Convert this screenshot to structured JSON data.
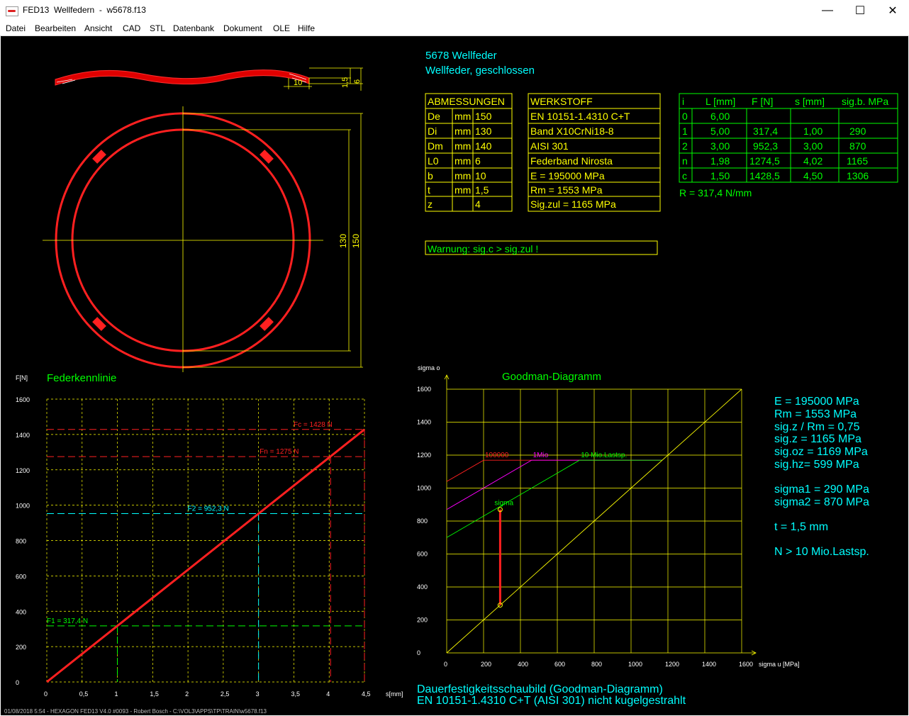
{
  "window": {
    "title": "FED13  Wellfedern  -  w5678.f13",
    "controls": {
      "minimize": "—",
      "maximize": "☐",
      "close": "✕"
    }
  },
  "menu": [
    "Datei",
    "Bearbeiten",
    "Ansicht",
    "CAD",
    "STL",
    "Datenbank",
    "Dokument",
    "OLE",
    "Hilfe"
  ],
  "header": {
    "title": "5678 Wellfeder",
    "subtitle": "Wellfeder, geschlossen"
  },
  "drawing": {
    "dims": {
      "b": "10",
      "t": "1,5",
      "l0": "6",
      "di": "130",
      "de": "150"
    }
  },
  "abmessungen": {
    "header": "ABMESSUNGEN",
    "rows": [
      [
        "De",
        "mm",
        "150"
      ],
      [
        "Di",
        "mm",
        "130"
      ],
      [
        "Dm",
        "mm",
        "140"
      ],
      [
        "L0",
        "mm",
        "6"
      ],
      [
        "b",
        "mm",
        "10"
      ],
      [
        "t",
        "mm",
        "1,5"
      ],
      [
        "z",
        "",
        "4"
      ]
    ]
  },
  "werkstoff": {
    "header": "WERKSTOFF",
    "rows": [
      "EN 10151-1.4310 C+T",
      "Band X10CrNi18-8",
      "AISI 301",
      "Federband Nirosta",
      "E = 195000 MPa",
      "Rm = 1553 MPa",
      "Sig.zul = 1165 MPa"
    ]
  },
  "loadtable": {
    "headers": [
      "i",
      "L [mm]",
      "F [N]",
      "s [mm]",
      "sig.b. MPa"
    ],
    "rows": [
      [
        "0",
        "6,00",
        "",
        "",
        ""
      ],
      [
        "1",
        "5,00",
        "317,4",
        "1,00",
        "290"
      ],
      [
        "2",
        "3,00",
        "952,3",
        "3,00",
        "870"
      ],
      [
        "n",
        "1,98",
        "1274,5",
        "4,02",
        "1165"
      ],
      [
        "c",
        "1,50",
        "1428,5",
        "4,50",
        "1306"
      ]
    ],
    "rate": "R = 317,4 N/mm"
  },
  "warning": "Warnung: sig.c > sig.zul !",
  "results": {
    "lines1": [
      "E = 195000 MPa",
      "Rm = 1553 MPa",
      "sig.z / Rm = 0,75",
      "sig.z = 1165 MPa",
      "sig.oz = 1169 MPa",
      "sig.hz=  599 MPa"
    ],
    "lines2": [
      "sigma1 =  290 MPa",
      "sigma2 =  870 MPa"
    ],
    "t": "t  = 1,5 mm",
    "n": "N > 10 Mio.Lastsp."
  },
  "footer": {
    "title1": "Dauerfestigkeitsschaubild (Goodman-Diagramm)",
    "title2": "EN 10151-1.4310 C+T (AISI 301) nicht kugelgestrahlt",
    "status": "01/08/2018 5:54 - HEXAGON FED13 V4.0 #0093 - Robert Bosch - C:\\VOL3\\APPS\\TP\\TRAIN\\w5678.f13"
  },
  "colors": {
    "canvas": "#000000",
    "yellow": "#ffff00",
    "cyan": "#00ffff",
    "green": "#00ff00",
    "red": "#ff0000",
    "magenta": "#ff00ff"
  },
  "chart_data": [
    {
      "type": "line",
      "title": "Federkennlinie",
      "ylabel": "F[N]",
      "xlabel": "s[mm]",
      "xlim": [
        0,
        4.5
      ],
      "ylim": [
        0,
        1600
      ],
      "x_ticks": [
        "0",
        "0,5",
        "1",
        "1,5",
        "2",
        "2,5",
        "3",
        "3,5",
        "4",
        "4,5"
      ],
      "y_ticks": [
        "0",
        "200",
        "400",
        "600",
        "800",
        "1000",
        "1200",
        "1400",
        "1600"
      ],
      "series": [
        {
          "x": [
            0,
            4.5
          ],
          "y": [
            0,
            1428.5
          ]
        }
      ],
      "markers": [
        {
          "label": "F1 = 317,4 N",
          "s": 1.0,
          "F": 317.4
        },
        {
          "label": "F2 = 952,3 N",
          "s": 3.0,
          "F": 952.3
        },
        {
          "label": "Fn = 1275 N",
          "s": 4.02,
          "F": 1274.5
        },
        {
          "label": "Fc = 1428 N",
          "s": 4.5,
          "F": 1428.5
        }
      ]
    },
    {
      "type": "line",
      "title": "Goodman-Diagramm",
      "ylabel": "sigma o",
      "xlabel": "sigma u [MPa]",
      "xlim": [
        0,
        1600
      ],
      "ylim": [
        0,
        1600
      ],
      "x_ticks": [
        "0",
        "200",
        "400",
        "600",
        "800",
        "1000",
        "1200",
        "1400",
        "1600"
      ],
      "y_ticks": [
        "0",
        "200",
        "400",
        "600",
        "800",
        "1000",
        "1200",
        "1400",
        "1600"
      ],
      "series": [
        {
          "name": "100000",
          "x": [
            0,
            200,
            1169
          ],
          "y": [
            1040,
            1169,
            1169
          ]
        },
        {
          "name": "1Mio",
          "x": [
            0,
            460,
            1169
          ],
          "y": [
            870,
            1169,
            1169
          ]
        },
        {
          "name": "10 Mio.Lastsp.",
          "x": [
            0,
            720,
            1169
          ],
          "y": [
            700,
            1169,
            1169
          ]
        },
        {
          "x": [
            0,
            1600
          ],
          "y": [
            0,
            1600
          ]
        }
      ],
      "sigma": {
        "label": "sigma",
        "x": 290,
        "y_from": 290,
        "y_to": 870
      }
    }
  ]
}
